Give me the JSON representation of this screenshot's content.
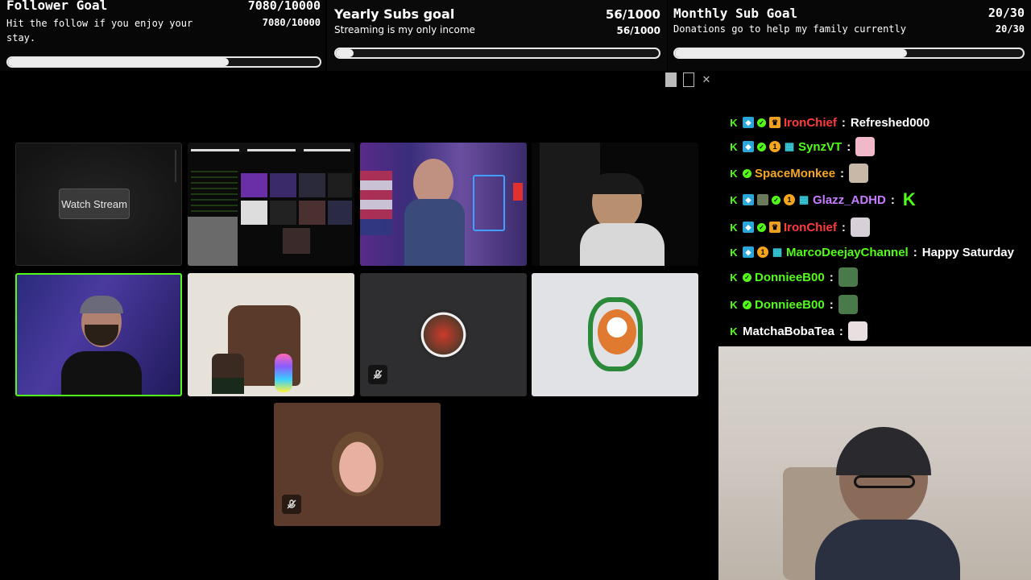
{
  "goals": {
    "follower": {
      "title": "Follower Goal",
      "count": "7080/10000",
      "desc": "Hit the follow if you enjoy your stay.",
      "count_small": "7080/10000",
      "progress": 0.708
    },
    "yearly": {
      "title": "Yearly Subs goal",
      "count": "56/1000",
      "desc": "Streaming is my only income",
      "count_small": "56/1000",
      "progress": 0.056
    },
    "monthly": {
      "title": "Monthly Sub Goal",
      "count": "20/30",
      "desc": "Donations go to help my family currently",
      "count_small": "20/30",
      "progress": 0.667
    }
  },
  "window_controls": {
    "minimize": "",
    "maximize": "",
    "close": "✕"
  },
  "grid": {
    "watch_stream_label": "Watch Stream"
  },
  "chat": {
    "messages": [
      {
        "user": "IronChief",
        "color": "#ff3b3b",
        "text": "Refreshed000",
        "partial": true
      },
      {
        "user": "SynzVT",
        "color": "#53fc18",
        "text": ""
      },
      {
        "user": "SpaceMonkee",
        "color": "#f5a623",
        "text": ""
      },
      {
        "user": "Glazz_ADHD",
        "color": "#c77dff",
        "text": ""
      },
      {
        "user": "IronChief",
        "color": "#ff3b3b",
        "text": ""
      },
      {
        "user": "MarcoDeejayChannel",
        "color": "#53fc18",
        "text": "Happy Saturday"
      },
      {
        "user": "DonnieeB00",
        "color": "#53fc18",
        "text": ""
      },
      {
        "user": "DonnieeB00",
        "color": "#53fc18",
        "text": ""
      },
      {
        "user": "MatchaBobaTea",
        "color": "#ffffff",
        "text": ""
      }
    ]
  },
  "colors": {
    "kick_green": "#53fc18",
    "active_tile_border": "#53fc18",
    "bar_fill": "#ececec"
  }
}
